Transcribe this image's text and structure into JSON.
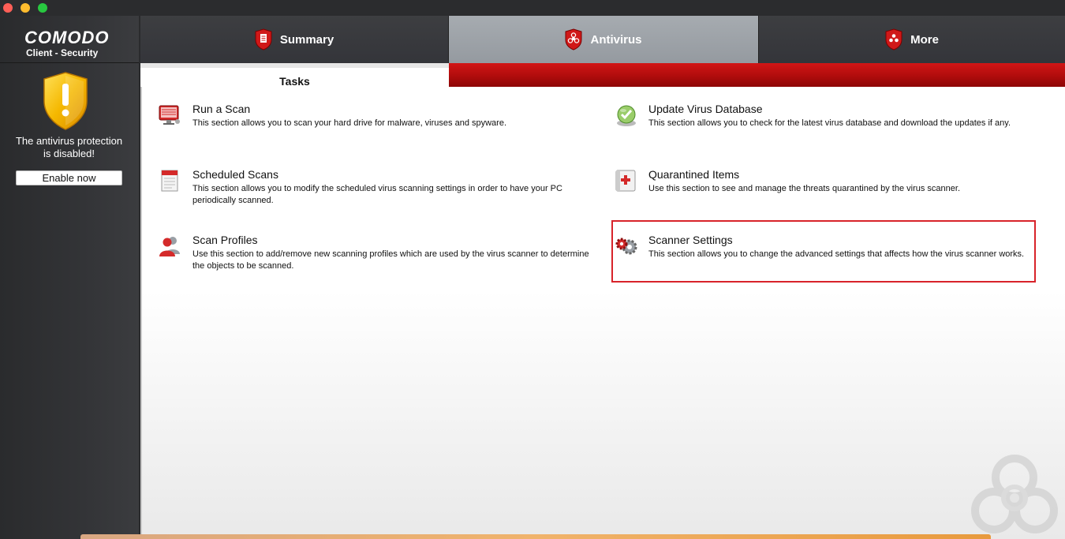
{
  "app": {
    "brand_name": "COMODO",
    "brand_subtitle": "Client - Security"
  },
  "sidebar": {
    "status_line1": "The antivirus protection",
    "status_line2": "is disabled!",
    "enable_button": "Enable now"
  },
  "tabs": [
    {
      "label": "Summary",
      "icon": "shield-document-icon"
    },
    {
      "label": "Antivirus",
      "icon": "shield-biohazard-icon",
      "selected": true
    },
    {
      "label": "More",
      "icon": "shield-dots-icon"
    }
  ],
  "subtabs": {
    "tasks": "Tasks"
  },
  "tasks": [
    {
      "title": "Run a Scan",
      "desc": "This section allows you to scan your hard drive for malware, viruses and spyware.",
      "icon": "monitor-scan-icon"
    },
    {
      "title": "Update Virus Database",
      "desc": "This section allows you to check for the latest virus database and download the updates if any.",
      "icon": "update-globe-icon"
    },
    {
      "title": "Scheduled Scans",
      "desc_line1": "This section allows you to modify the scheduled virus scanning settings in order to have your PC",
      "desc_line2": "periodically scanned.",
      "icon": "calendar-icon"
    },
    {
      "title": "Quarantined Items",
      "desc": "Use this section to see and manage the threats quarantined by the virus scanner.",
      "icon": "quarantine-box-icon"
    },
    {
      "title": "Scan Profiles",
      "desc_line1": "Use this section to add/remove new scanning profiles which are used by the virus scanner to determine",
      "desc_line2": "the objects to be scanned.",
      "icon": "profiles-users-icon"
    },
    {
      "title": "Scanner Settings",
      "desc": "This section allows you to change the advanced settings that affects how the virus scanner works.",
      "icon": "gears-icon"
    }
  ],
  "colors": {
    "accent_red": "#c40f0f",
    "highlight_border": "#d8232a",
    "warning_yellow": "#f5b800"
  }
}
